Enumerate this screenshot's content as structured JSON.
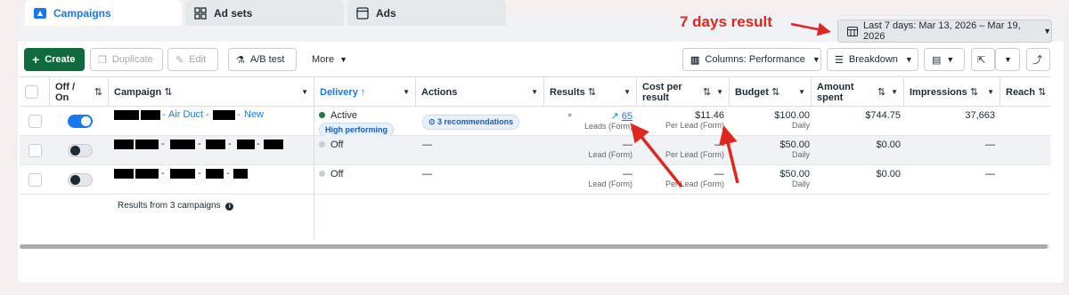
{
  "annotation": {
    "text": "7 days result"
  },
  "tabs": [
    {
      "label": "Campaigns",
      "icon": "folder-icon"
    },
    {
      "label": "Ad sets",
      "icon": "grid-icon"
    },
    {
      "label": "Ads",
      "icon": "ad-icon"
    }
  ],
  "date_range": {
    "label": "Last 7 days: Mar 13, 2026 – Mar 19, 2026"
  },
  "toolbar": {
    "create": "Create",
    "duplicate": "Duplicate",
    "edit": "Edit",
    "ab_test": "A/B test",
    "more": "More",
    "columns": "Columns: Performance",
    "breakdown": "Breakdown"
  },
  "columns": {
    "off_on": "Off / On",
    "campaign": "Campaign",
    "delivery": "Delivery",
    "actions": "Actions",
    "results": "Results",
    "cost_per_result": "Cost per result",
    "budget": "Budget",
    "amount_spent": "Amount spent",
    "impressions": "Impressions",
    "reach": "Reach"
  },
  "rows": [
    {
      "campaign_sep1": "-",
      "campaign_text": "Air Duct",
      "campaign_sep2": "-",
      "campaign_sep3": "-",
      "campaign_suffix": "New",
      "delivery": "Active",
      "delivery_badge": "High performing",
      "actions": "3 recommendations",
      "results": "65",
      "results_sub": "Leads (Form)",
      "cost": "$11.46",
      "cost_sub": "Per Lead (Form)",
      "budget": "$100.00",
      "budget_sub": "Daily",
      "spent": "$744.75",
      "impressions": "37,663"
    },
    {
      "campaign_sep1": "-",
      "campaign_sep2": "-",
      "campaign_sep3": "-",
      "campaign_sep4": "-",
      "delivery": "Off",
      "actions": "—",
      "results": "—",
      "results_sub": "Lead (Form)",
      "cost": "—",
      "cost_sub": "Per Lead (Form)",
      "budget": "$50.00",
      "budget_sub": "Daily",
      "spent": "$0.00",
      "impressions": "—"
    },
    {
      "campaign_sep1": "-",
      "campaign_sep2": "-",
      "campaign_sep3": "-",
      "delivery": "Off",
      "actions": "—",
      "results": "—",
      "results_sub": "Lead (Form)",
      "cost": "—",
      "cost_sub": "Per Lead (Form)",
      "budget": "$50.00",
      "budget_sub": "Daily",
      "spent": "$0.00",
      "impressions": "—"
    }
  ],
  "footer": {
    "results_from": "Results from 3 campaigns"
  },
  "colors": {
    "accent": "#1877f2",
    "create": "#0f6a3e",
    "annotation": "#e0261e",
    "active_dot": "#1b7f3b",
    "off_dot": "#c9ccd1"
  }
}
